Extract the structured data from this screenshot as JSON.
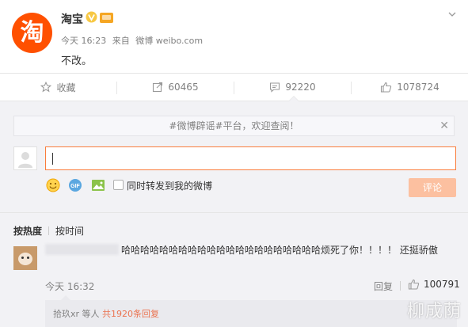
{
  "post": {
    "author": "淘宝",
    "avatar_glyph": "淘",
    "brand_color": "#ff5000",
    "verified_color": "#f7c844",
    "time": "今天 16:23",
    "source_prefix": "来自",
    "source": "微博 weibo.com",
    "content": "不改。"
  },
  "actions": {
    "favorite": "收藏",
    "repost_count": "60465",
    "comment_count": "92220",
    "like_count": "1078724"
  },
  "comment_box": {
    "notice_topic": "#微博辟谣#平台",
    "notice_suffix": "，欢迎查阅！",
    "notice_close": "✕",
    "forward_label": "同时转发到我的微博",
    "submit_label": "评论",
    "submit_color": "#fcc0a0"
  },
  "sort": {
    "by_hot": "按热度",
    "by_time": "按时间"
  },
  "comment": {
    "text": "哈哈哈哈哈哈哈哈哈哈哈哈哈哈哈哈哈哈哈哈哈烦死了你！！！！ 还挺骄傲",
    "time": "今天 16:32",
    "reply": "回复",
    "likes": "100791"
  },
  "replies": {
    "user": "拾玖xr",
    "middle": " 等人 ",
    "count_text": "共1920条回复"
  },
  "watermark": "柳成荫",
  "accent_color": "#eb7350"
}
